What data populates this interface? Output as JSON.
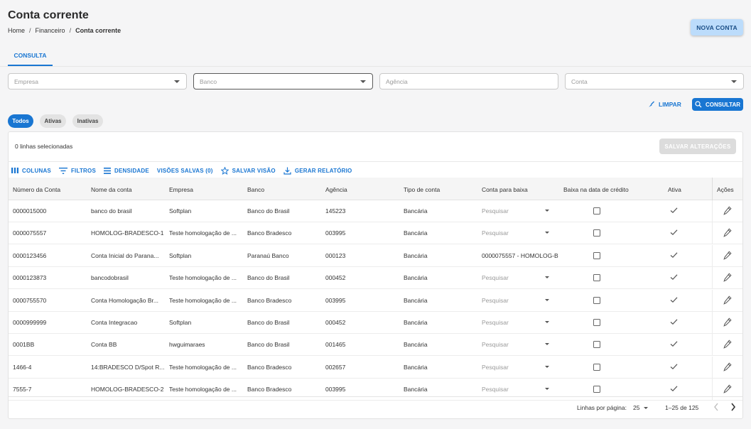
{
  "header": {
    "title": "Conta corrente",
    "breadcrumb": [
      "Home",
      "Financeiro",
      "Conta corrente"
    ],
    "new_button": "NOVA CONTA"
  },
  "tabs": [
    {
      "label": "CONSULTA",
      "active": true
    }
  ],
  "filters": {
    "empresa_placeholder": "Empresa",
    "banco_placeholder": "Banco",
    "agencia_placeholder": "Agência",
    "conta_placeholder": "Conta"
  },
  "actions": {
    "clear": "LIMPAR",
    "consult": "CONSULTAR"
  },
  "status_chips": [
    {
      "label": "Todos",
      "active": true
    },
    {
      "label": "Ativas",
      "active": false
    },
    {
      "label": "Inativas",
      "active": false
    }
  ],
  "grid": {
    "selected_text": "0 linhas selecionadas",
    "save_button": "SALVAR ALTERAÇÕES",
    "toolbar": {
      "columns": "COLUNAS",
      "filters": "FILTROS",
      "density": "DENSIDADE",
      "saved_views": "VISÕES SALVAS (0)",
      "save_view": "SALVAR VISÃO",
      "report": "GERAR RELATÓRIO"
    },
    "columns": [
      "Número da Conta",
      "Nome da conta",
      "Empresa",
      "Banco",
      "Agência",
      "Tipo de conta",
      "Conta para baixa",
      "Baixa na data de crédito",
      "Ativa",
      "Ações"
    ],
    "rows": [
      {
        "numero": "0000015000",
        "nome": "banco do brasil",
        "empresa": "Softplan",
        "banco": "Banco do Brasil",
        "agencia": "145223",
        "tipo": "Bancária",
        "baixa": "Pesquisar",
        "baixa_is_placeholder": true
      },
      {
        "numero": "0000075557",
        "nome": "HOMOLOG-BRADESCO-1",
        "empresa": "Teste homologação de ...",
        "banco": "Banco Bradesco",
        "agencia": "003995",
        "tipo": "Bancária",
        "baixa": "Pesquisar",
        "baixa_is_placeholder": true
      },
      {
        "numero": "0000123456",
        "nome": "Conta Inicial do Parana...",
        "empresa": "Softplan",
        "banco": "Paranaú Banco",
        "agencia": "000123",
        "tipo": "Bancária",
        "baixa": "0000075557 - HOMOLOG-B",
        "baixa_is_placeholder": false
      },
      {
        "numero": "0000123873",
        "nome": "bancodobrasil",
        "empresa": "Teste homologação de ...",
        "banco": "Banco do Brasil",
        "agencia": "000452",
        "tipo": "Bancária",
        "baixa": "Pesquisar",
        "baixa_is_placeholder": true
      },
      {
        "numero": "0000755570",
        "nome": "Conta Homologação Br...",
        "empresa": "Teste homologação de ...",
        "banco": "Banco Bradesco",
        "agencia": "003995",
        "tipo": "Bancária",
        "baixa": "Pesquisar",
        "baixa_is_placeholder": true
      },
      {
        "numero": "0000999999",
        "nome": "Conta Integracao",
        "empresa": "Softplan",
        "banco": "Banco do Brasil",
        "agencia": "000452",
        "tipo": "Bancária",
        "baixa": "Pesquisar",
        "baixa_is_placeholder": true
      },
      {
        "numero": "0001BB",
        "nome": "Conta BB",
        "empresa": "hwguimaraes",
        "banco": "Banco do Brasil",
        "agencia": "001465",
        "tipo": "Bancária",
        "baixa": "Pesquisar",
        "baixa_is_placeholder": true
      },
      {
        "numero": "1466-4",
        "nome": "14:BRADESCO D/Spot R...",
        "empresa": "Teste homologação de ...",
        "banco": "Banco Bradesco",
        "agencia": "002657",
        "tipo": "Bancária",
        "baixa": "Pesquisar",
        "baixa_is_placeholder": true
      },
      {
        "numero": "7555-7",
        "nome": "HOMOLOG-BRADESCO-2",
        "empresa": "Teste homologação de ...",
        "banco": "Banco Bradesco",
        "agencia": "003995",
        "tipo": "Bancária",
        "baixa": "Pesquisar",
        "baixa_is_placeholder": true
      }
    ],
    "pagination": {
      "rows_per_page_label": "Linhas por página:",
      "rows_per_page": "25",
      "range": "1–25 de 125"
    }
  },
  "colors": {
    "primary": "#1976d2",
    "primary_light": "#bcdcfb",
    "disabled": "#dcdcdc"
  }
}
